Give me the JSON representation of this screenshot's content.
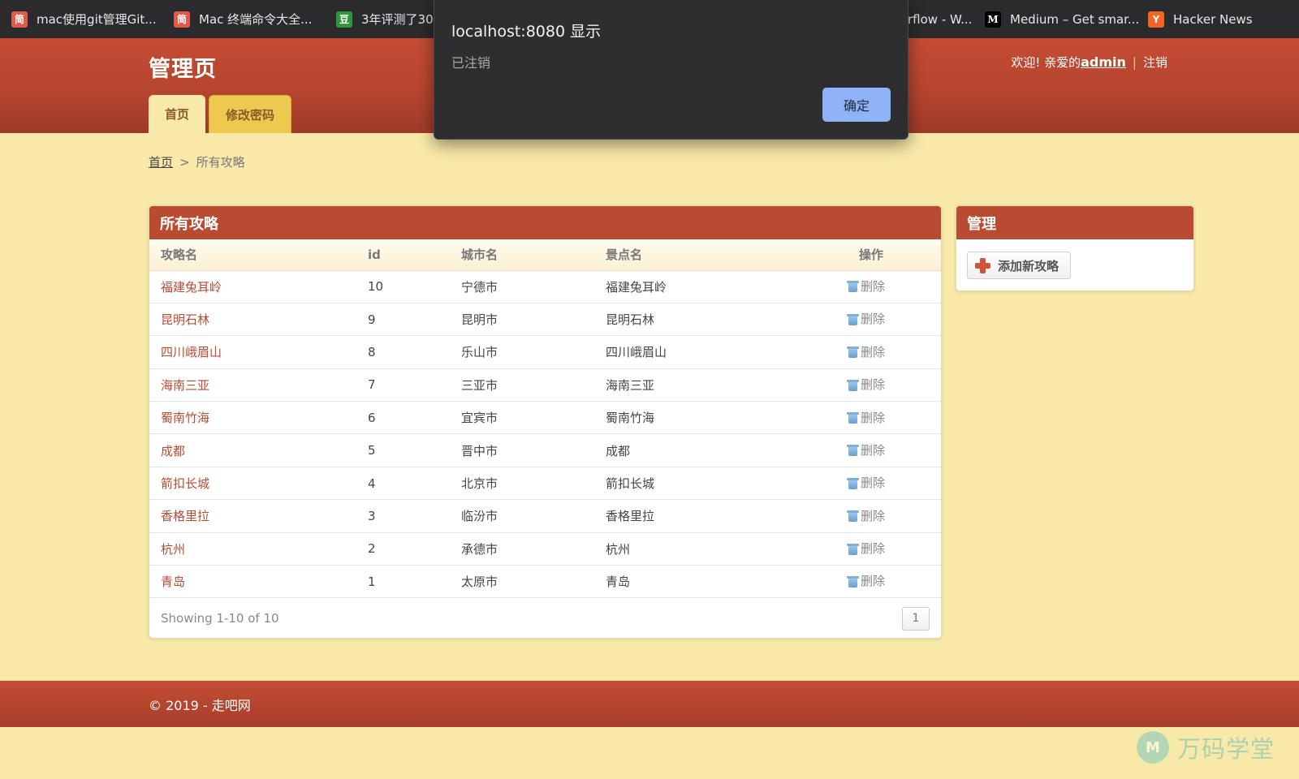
{
  "bookmarks": [
    {
      "icon_text": "简",
      "icon_color": "#e35b47",
      "label": "mac使用git管理Git..."
    },
    {
      "icon_text": "简",
      "icon_color": "#e35b47",
      "label": "Mac 终端命令大全..."
    },
    {
      "icon_text": "豆",
      "icon_color": "#2e963d",
      "label": "3年评测了30"
    },
    {
      "icon_text": "",
      "icon_color": "",
      "label": "rflow - W..."
    },
    {
      "icon_text": "M",
      "icon_color": "#000000",
      "label": "Medium – Get smar..."
    },
    {
      "icon_text": "Y",
      "icon_color": "#f26522",
      "label": "Hacker News"
    }
  ],
  "header": {
    "site_title": "管理页",
    "welcome": "欢迎!  亲爱的",
    "username": "admin",
    "separator": "|",
    "logout": "注销",
    "tabs": [
      {
        "label": "首页",
        "active": true
      },
      {
        "label": "修改密码",
        "active": false
      }
    ]
  },
  "breadcrumb": {
    "home": "首页",
    "separator": ">",
    "current": "所有攻略"
  },
  "main_panel": {
    "title": "所有攻略",
    "columns": [
      "攻略名",
      "id",
      "城市名",
      "景点名",
      "操作"
    ],
    "rows": [
      {
        "name": "福建兔耳岭",
        "id": "10",
        "city": "宁德市",
        "spot": "福建兔耳岭",
        "action": "删除"
      },
      {
        "name": "昆明石林",
        "id": "9",
        "city": "昆明市",
        "spot": "昆明石林",
        "action": "删除"
      },
      {
        "name": "四川峨眉山",
        "id": "8",
        "city": "乐山市",
        "spot": "四川峨眉山",
        "action": "删除"
      },
      {
        "name": "海南三亚",
        "id": "7",
        "city": "三亚市",
        "spot": "海南三亚",
        "action": "删除"
      },
      {
        "name": "蜀南竹海",
        "id": "6",
        "city": "宜宾市",
        "spot": "蜀南竹海",
        "action": "删除"
      },
      {
        "name": "成都",
        "id": "5",
        "city": "晋中市",
        "spot": "成都",
        "action": "删除"
      },
      {
        "name": "箭扣长城",
        "id": "4",
        "city": "北京市",
        "spot": "箭扣长城",
        "action": "删除"
      },
      {
        "name": "香格里拉",
        "id": "3",
        "city": "临汾市",
        "spot": "香格里拉",
        "action": "删除"
      },
      {
        "name": "杭州",
        "id": "2",
        "city": "承德市",
        "spot": "杭州",
        "action": "删除"
      },
      {
        "name": "青岛",
        "id": "1",
        "city": "太原市",
        "spot": "青岛",
        "action": "删除"
      }
    ],
    "summary": "Showing 1-10 of 10",
    "current_page": "1"
  },
  "side_panel": {
    "title": "管理",
    "add_button": "添加新攻略"
  },
  "footer": {
    "copyright": "© 2019 - 走吧网"
  },
  "watermark": {
    "logo_text": "M",
    "text": "万码学堂"
  },
  "dialog": {
    "title": "localhost:8080 显示",
    "message": "已注销",
    "ok_label": "确定"
  },
  "colors": {
    "header_red": "#b84b31",
    "page_bg": "#f8e9a9",
    "link_red": "#b84b31",
    "dialog_button": "#8fb3f6"
  }
}
